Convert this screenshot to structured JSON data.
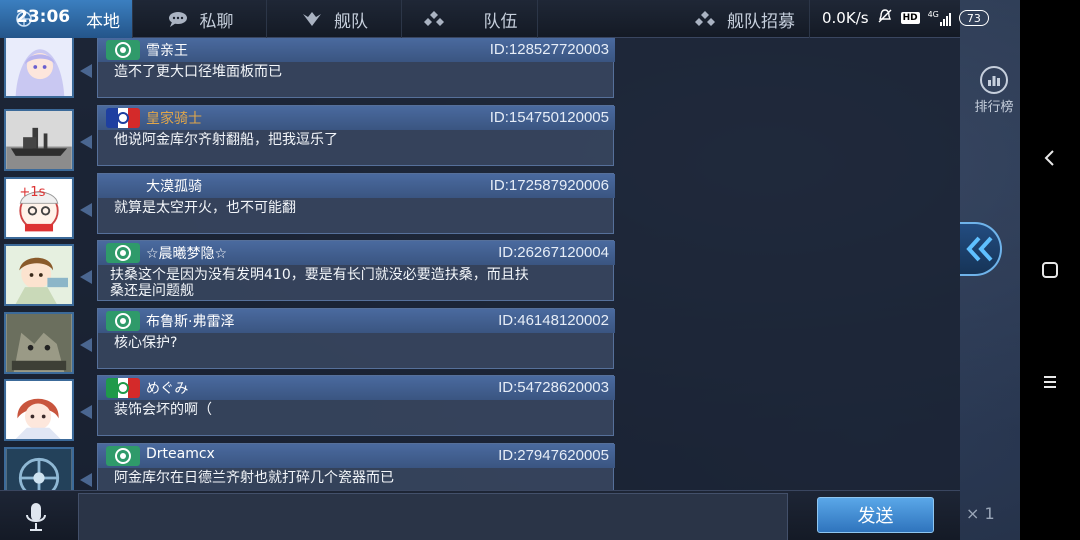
{
  "status": {
    "time": "23:06",
    "network_speed": "0.0K/s",
    "hd": "HD",
    "signal": "4G",
    "battery": "73"
  },
  "tabs": [
    {
      "label": "本地",
      "active": true
    },
    {
      "label": "私聊",
      "active": false,
      "icon": "chat-icon"
    },
    {
      "label": "舰队",
      "active": false,
      "icon": "fleet-icon"
    },
    {
      "label": "队伍",
      "active": false,
      "icon": "team-icon"
    },
    {
      "label": "舰队招募",
      "active": false,
      "icon": "recruit-icon"
    }
  ],
  "messages": [
    {
      "name": "雪亲王",
      "id": "ID:128527720003",
      "text": "造不了更大口径堆面板而已",
      "flag": "green",
      "name_color": "white"
    },
    {
      "name": "皇家骑士",
      "id": "ID:154750120005",
      "text": "他说阿金库尔齐射翻船，把我逗乐了",
      "flag": "tricolor",
      "name_color": "gold"
    },
    {
      "name": "大漠孤骑",
      "id": "ID:172587920006",
      "text": "就算是太空开火，也不可能翻",
      "flag": "none",
      "name_color": "white"
    },
    {
      "name": "☆晨曦梦隐☆",
      "id": "ID:26267120004",
      "text": "扶桑这个是因为没有发明410，要是有长门就没必要造扶桑，而且扶桑还是问题舰",
      "flag": "green",
      "name_color": "white"
    },
    {
      "name": "布鲁斯·弗雷泽",
      "id": "ID:46148120002",
      "text": "核心保护?",
      "flag": "green",
      "name_color": "white"
    },
    {
      "name": "めぐみ",
      "id": "ID:54728620003",
      "text": "装饰会坏的啊（",
      "flag": "italy",
      "name_color": "white"
    },
    {
      "name": "Drteamcx",
      "id": "ID:27947620005",
      "text": "阿金库尔在日德兰齐射也就打碎几个瓷器而已",
      "flag": "green",
      "name_color": "white"
    }
  ],
  "side": {
    "rank_label": "排行榜"
  },
  "input": {
    "placeholder": "",
    "value": ""
  },
  "send_label": "发送",
  "counter": "× 1",
  "colors": {
    "active_tab": "#3b7fc0",
    "name_gold": "#e0a64a",
    "send_button": "#3f8ad0"
  }
}
